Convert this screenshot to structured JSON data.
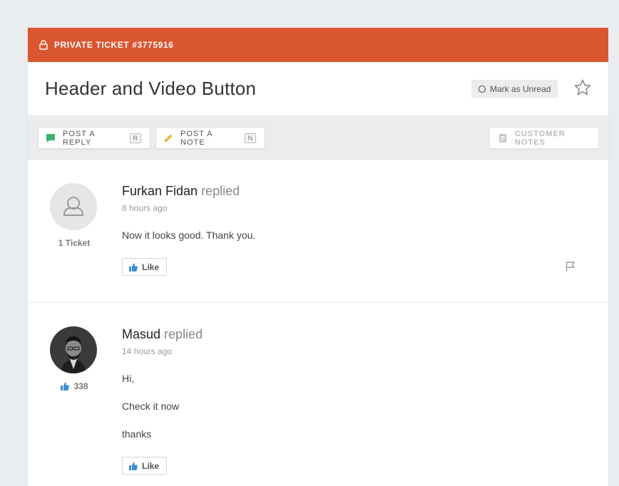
{
  "ticket": {
    "banner_label": "PRIVATE TICKET #3775916",
    "title": "Header and Video Button",
    "mark_unread_label": "Mark as Unread"
  },
  "toolbar": {
    "reply_label": "POST A REPLY",
    "reply_key": "R",
    "note_label": "POST A NOTE",
    "note_key": "N",
    "customer_notes_label": "CUSTOMER NOTES"
  },
  "messages": [
    {
      "author": "Furkan Fidan",
      "verb": "replied",
      "time": "8 hours ago",
      "avatar_meta": "1 Ticket",
      "body": [
        "Now it looks good. Thank you."
      ],
      "like_label": "Like"
    },
    {
      "author": "Masud",
      "verb": "replied",
      "time": "14 hours ago",
      "avatar_meta": "338",
      "body": [
        "Hi,",
        "Check it now",
        "thanks"
      ],
      "like_label": "Like"
    }
  ],
  "icons": {
    "banner": "lock-icon",
    "unread": "circle-icon",
    "favorite": "star-icon",
    "reply": "speech-bubble-icon",
    "note": "pencil-icon",
    "customer_notes": "notebook-icon",
    "like": "thumbs-up-icon",
    "report": "flag-icon"
  },
  "colors": {
    "banner": "#da5630",
    "reply_icon": "#3cb46e",
    "note_icon": "#f0b43c",
    "like_icon": "#3b8ed6"
  }
}
